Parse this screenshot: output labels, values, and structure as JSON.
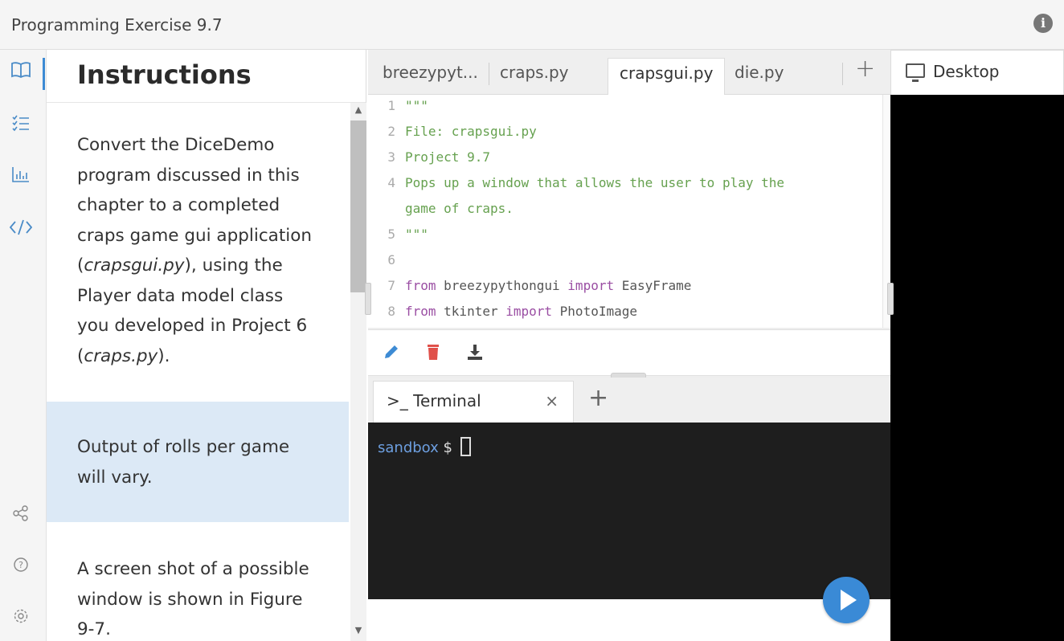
{
  "topbar": {
    "title": "Programming Exercise 9.7",
    "info_icon": "i"
  },
  "rail": {
    "items": [
      {
        "name": "book-icon",
        "glyph": "📖"
      },
      {
        "name": "checklist-icon",
        "glyph": "☰"
      },
      {
        "name": "chart-icon",
        "glyph": "|.|"
      },
      {
        "name": "code-icon",
        "glyph": "</>"
      },
      {
        "name": "share-icon",
        "glyph": "∝"
      },
      {
        "name": "help-icon",
        "glyph": "?"
      },
      {
        "name": "settings-icon",
        "glyph": "⚙"
      }
    ]
  },
  "instructions": {
    "title": "Instructions",
    "p1_a": "Convert the DiceDemo program discussed in this chapter to a completed craps game gui application (",
    "p1_em1": "crapsgui.py",
    "p1_b": "), using the Player data model class you developed in Project 6 (",
    "p1_em2": "craps.py",
    "p1_c": ").",
    "p2": "Output of rolls per game will vary.",
    "p3": "A screen shot of a possible window is shown in Figure 9-7."
  },
  "editor": {
    "tabs": [
      "breezypyt...",
      "craps.py",
      "crapsgui.py",
      "die.py"
    ],
    "active_tab": "crapsgui.py",
    "add_tab": "+",
    "lines": [
      {
        "n": "1",
        "t": "\"\"\""
      },
      {
        "n": "2",
        "t": "File: crapsgui.py"
      },
      {
        "n": "3",
        "t": "Project 9.7"
      },
      {
        "n": "4",
        "t": "Pops up a window that allows the user to play the"
      },
      {
        "n": "",
        "t": "game of craps."
      },
      {
        "n": "5",
        "t": "\"\"\""
      },
      {
        "n": "6",
        "t": ""
      },
      {
        "n": "7",
        "kw1": "from",
        "mod": " breezypythongui ",
        "kw2": "import",
        "obj": " EasyFrame"
      },
      {
        "n": "8",
        "kw1": "from",
        "mod": " tkinter ",
        "kw2": "import",
        "obj": " PhotoImage"
      }
    ]
  },
  "terminal": {
    "tab_label": "Terminal",
    "tab_close": "×",
    "add": "+",
    "host": "sandbox",
    "dollar": "$"
  },
  "desktop": {
    "tab_label": "Desktop"
  },
  "colors": {
    "accent": "#3a8ad6",
    "terminal_bg": "#1e1e1e",
    "highlight": "#dce9f6"
  }
}
